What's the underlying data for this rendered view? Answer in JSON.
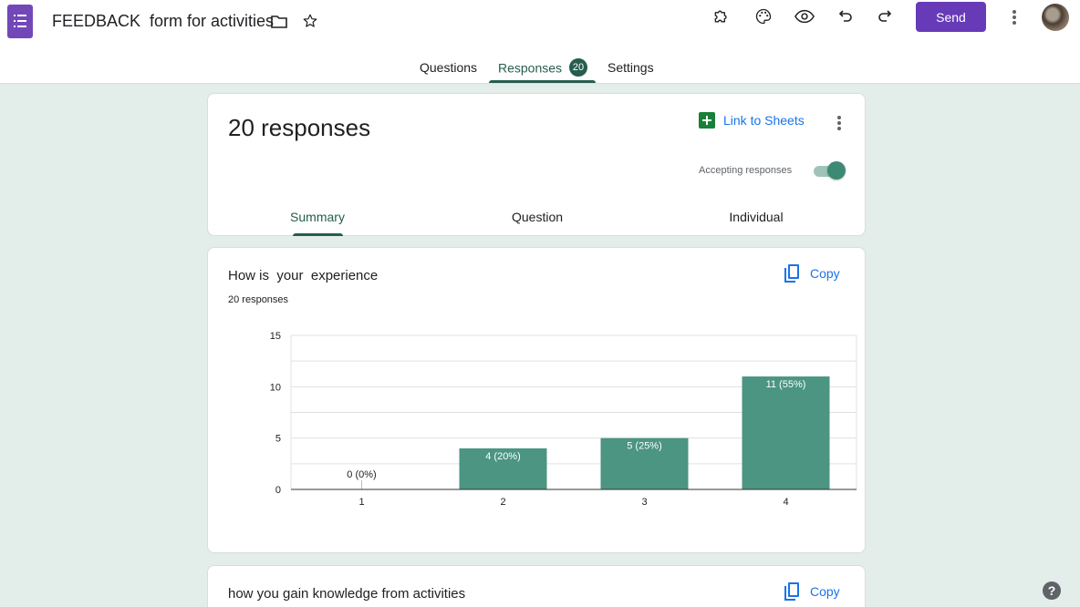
{
  "header": {
    "title": "FEEDBACK  form for activities",
    "send_label": "Send",
    "icons": [
      "forms-app-icon",
      "folder-icon",
      "star-icon",
      "addons-icon",
      "palette-icon",
      "preview-eye-icon",
      "undo-icon",
      "redo-icon",
      "more-vert-icon",
      "avatar"
    ]
  },
  "tabs": {
    "questions": "Questions",
    "responses": "Responses",
    "responses_count": "20",
    "settings": "Settings"
  },
  "summary_card": {
    "response_count": "20 responses",
    "link_sheets": "Link to Sheets",
    "accepting_label": "Accepting responses",
    "accepting_on": true,
    "subtabs": [
      "Summary",
      "Question",
      "Individual"
    ]
  },
  "question1": {
    "title": "How is  your  experience",
    "subtitle": "20 responses",
    "copy_label": "Copy"
  },
  "question2": {
    "title": "how you gain knowledge from activities",
    "copy_label": "Copy"
  },
  "colors": {
    "accent": "#265d4f",
    "bar": "#4b9582",
    "send": "#673ab7",
    "link": "#1a73e8",
    "background": "#e3ede9"
  },
  "chart_data": {
    "type": "bar",
    "categories": [
      "1",
      "2",
      "3",
      "4"
    ],
    "values": [
      0,
      4,
      5,
      11
    ],
    "data_labels": [
      "0 (0%)",
      "4 (20%)",
      "5 (25%)",
      "11 (55%)"
    ],
    "yticks": [
      "0",
      "5",
      "10",
      "15"
    ],
    "ylim": [
      0,
      15
    ],
    "grid": true
  }
}
